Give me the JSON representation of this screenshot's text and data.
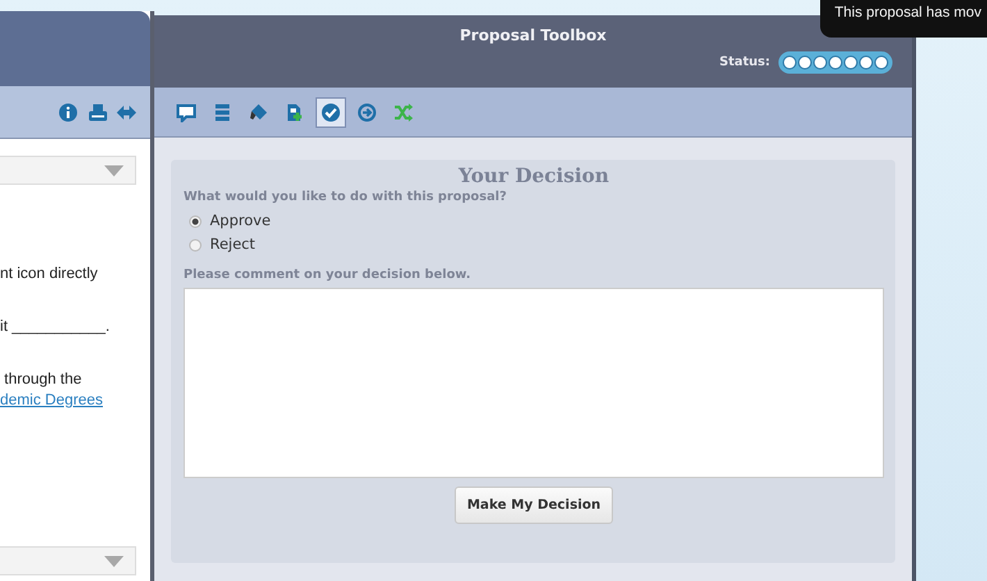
{
  "left_panel": {
    "toolbar": [
      {
        "kind": "info"
      },
      {
        "kind": "print"
      },
      {
        "kind": "resize"
      }
    ],
    "dropdowns": [
      {
        "kind": "select"
      },
      {
        "kind": "select"
      }
    ],
    "texts": [
      {
        "kind": "line",
        "text": "nt icon directly"
      },
      {
        "kind": "line",
        "text": "it ___________."
      },
      {
        "kind": "line",
        "text": " through the"
      },
      {
        "kind": "link",
        "text": "demic Degrees"
      }
    ]
  },
  "toolbox": {
    "title": "Proposal Toolbox",
    "status_label": "Status:",
    "status_steps": [
      {
        "done": false
      },
      {
        "done": false
      },
      {
        "done": false
      },
      {
        "done": false
      },
      {
        "done": false
      },
      {
        "done": false
      },
      {
        "done": false
      }
    ],
    "toolbar": [
      {
        "kind": "comment",
        "selected": false
      },
      {
        "kind": "list",
        "selected": false
      },
      {
        "kind": "eraser",
        "selected": false
      },
      {
        "kind": "add-document",
        "selected": false
      },
      {
        "kind": "check",
        "selected": true
      },
      {
        "kind": "arrow",
        "selected": false
      },
      {
        "kind": "shuffle",
        "selected": false
      }
    ],
    "decision": {
      "title": "Your Decision",
      "question": "What would you like to do with this proposal?",
      "options": [
        {
          "label": "Approve",
          "selected": true
        },
        {
          "label": "Reject",
          "selected": false
        }
      ],
      "comment_label": "Please comment on your decision below.",
      "button": "Make My Decision"
    }
  },
  "tooltip": "This proposal has mov"
}
